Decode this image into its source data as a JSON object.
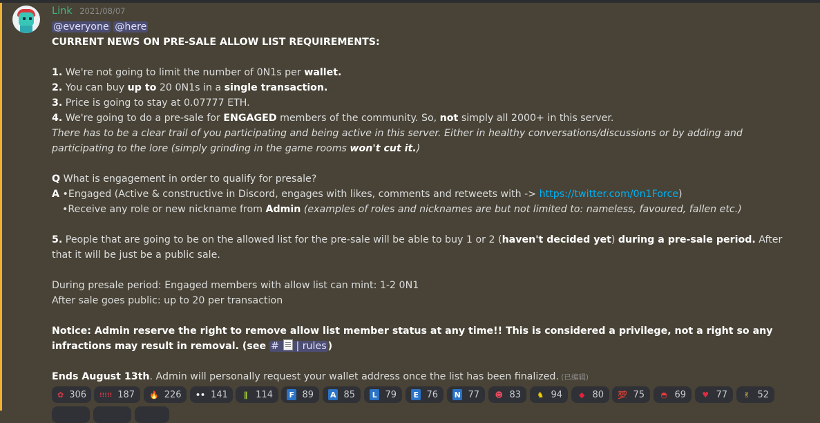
{
  "author": {
    "name": "Link",
    "timestamp": "2021/08/07"
  },
  "mentions": [
    "@everyone",
    "@here"
  ],
  "message": {
    "headline": "CURRENT NEWS ON PRE-SALE ALLOW LIST REQUIREMENTS:",
    "p1_num": "1.",
    "p1_text": " We're not going to limit the number of 0N1s per ",
    "p1_bold": "wallet.",
    "p2_num": "2.",
    "p2_a": " You can buy ",
    "p2_bold1": "up to",
    "p2_b": " 20 0N1s in a ",
    "p2_bold2": "single transaction.",
    "p3_num": "3.",
    "p3_text": " Price is going to stay at 0.07777 ETH.",
    "p4_num": "4.",
    "p4_a": " We're going to do a pre-sale for ",
    "p4_bold1": "ENGAGED",
    "p4_b": " members of the community. So, ",
    "p4_bold2": "not",
    "p4_c": " simply all 2000+ in this server.",
    "italic_a": "There has to be a clear trail of you participating and being active in this server. Either in healthy conversations/discussions or by adding and participating to the lore (simply grinding in the game rooms ",
    "italic_bold": "won't cut it.",
    "italic_b": ")",
    "q_label": "Q",
    "q_text": " What is engagement in order to qualify for presale?",
    "a_label": "A",
    "a_text": " •Engaged (Active & constructive in Discord, engages with likes, comments and retweets with -> ",
    "a_link": "https://twitter.com/0n1Force",
    "a_close": ")",
    "a2_text": "•Receive any role or new nickname from ",
    "a2_bold": "Admin",
    "a2_italic": " (examples of roles and nicknames are but not limited to: nameless, favoured, fallen etc.)",
    "p5_num": "5.",
    "p5_a": " People that are going to be on the allowed list for the pre-sale will be able to buy 1 or 2 (",
    "p5_bold1": "haven't decided yet",
    "p5_b": ") ",
    "p5_bold2": "during a pre-sale period.",
    "p5_c": " After that it will be just be a public sale.",
    "presale_line": "During presale period: Engaged members with allow list can mint: 1-2 0N1",
    "public_line": "After sale goes public: up to 20 per transaction",
    "notice_bold": " Notice: Admin reserve the right to remove allow list member status at any time!! This is considered a privilege, not a right so any infractions may result in removal. (see ",
    "channel_name": "# ",
    "channel_rest": "| rules",
    "notice_close": ")",
    "ends_bold": "Ends August 13th",
    "ends_text": ". Admin will personally request your wallet address once the list has been finalized.",
    "edited": " (已编辑)"
  },
  "reactions": [
    {
      "icon": "red-creature-emoji",
      "glyph": "✿",
      "color": "#d93b48",
      "count": "306"
    },
    {
      "icon": "red-bars-emoji",
      "glyph": "!!!!!",
      "color": "#d93b48",
      "count": "187"
    },
    {
      "icon": "fire-emoji",
      "glyph": "🔥",
      "color": "#ff8a1c",
      "count": "226"
    },
    {
      "icon": "eyes-emoji",
      "glyph": "••",
      "color": "#ffffff",
      "count": "141"
    },
    {
      "icon": "green-graffiti-emoji",
      "glyph": "∥",
      "color": "#b7e43c",
      "count": "114"
    },
    {
      "icon": "letter-f-emoji",
      "glyph": "F",
      "color": "#2a73c7",
      "count": "89"
    },
    {
      "icon": "letter-a-emoji",
      "glyph": "A",
      "color": "#2a73c7",
      "count": "85"
    },
    {
      "icon": "letter-l-emoji",
      "glyph": "L",
      "color": "#2a73c7",
      "count": "79"
    },
    {
      "icon": "letter-e-emoji",
      "glyph": "E",
      "color": "#2a73c7",
      "count": "76"
    },
    {
      "icon": "letter-n-emoji",
      "glyph": "N",
      "color": "#2a73c7",
      "count": "77"
    },
    {
      "icon": "red-face-emoji",
      "glyph": "☻",
      "color": "#e84a5f",
      "count": "83"
    },
    {
      "icon": "yellow-figure-emoji",
      "glyph": "♞",
      "color": "#f5d300",
      "count": "94"
    },
    {
      "icon": "red-gem-emoji",
      "glyph": "◆",
      "color": "#e0243c",
      "count": "80"
    },
    {
      "icon": "hundred-points-emoji",
      "glyph": "💯",
      "color": "#2bd43b",
      "count": "75"
    },
    {
      "icon": "watermelon-emoji",
      "glyph": "◓",
      "color": "#e83b3b",
      "count": "69"
    },
    {
      "icon": "red-heart-emoji",
      "glyph": "♥",
      "color": "#dd2e44",
      "count": "77"
    },
    {
      "icon": "crossed-fingers-emoji",
      "glyph": "✌",
      "color": "#ffcb4c",
      "count": "52"
    }
  ],
  "colors": {
    "background": "#484336",
    "mention_bar": "#f0b232",
    "username": "#43b581",
    "link": "#00b0f4"
  }
}
